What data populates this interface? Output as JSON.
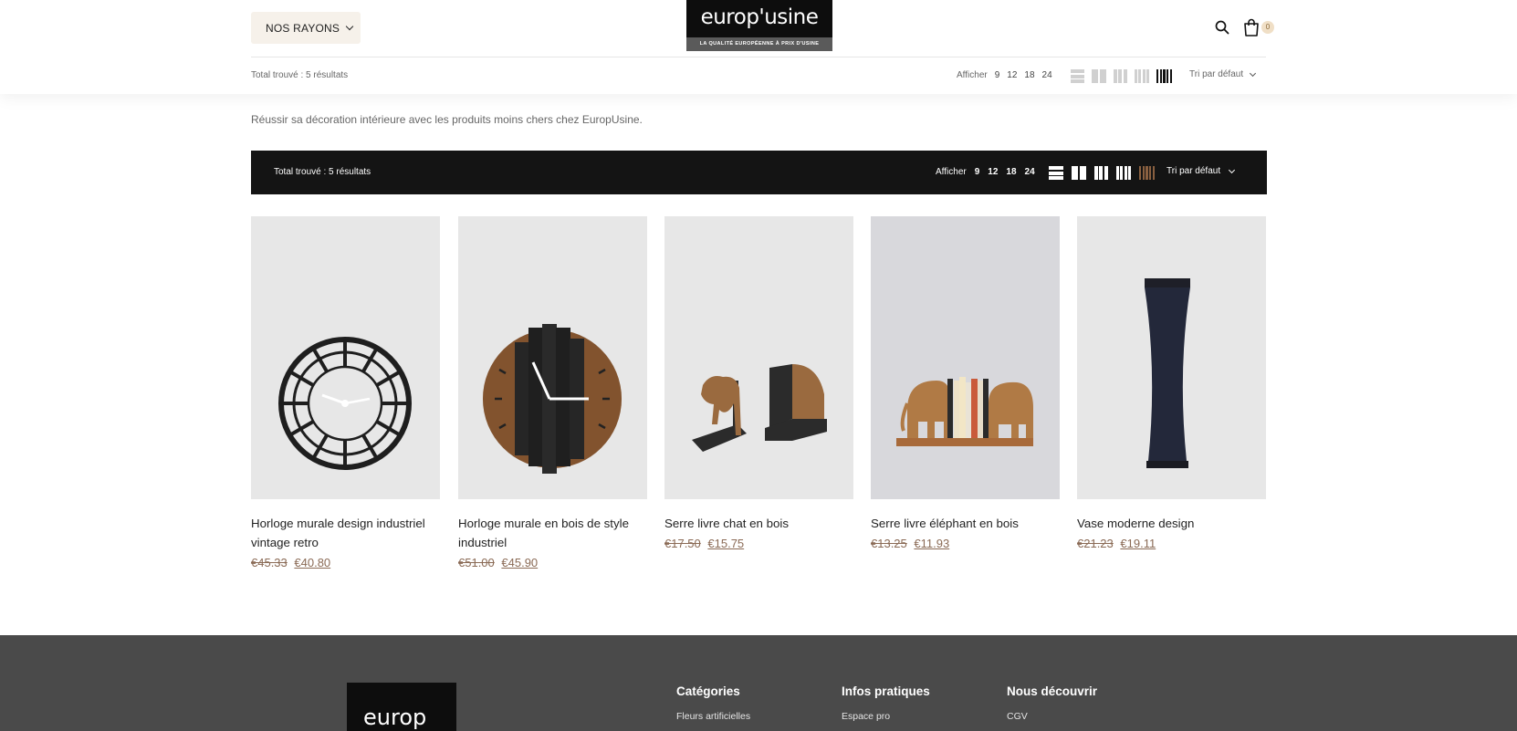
{
  "header": {
    "nav_label": "NOS RAYONS",
    "logo_text": "europ'usine",
    "logo_tagline": "LA QUALITÉ EUROPÉENNE À PRIX D'USINE",
    "cart_count": "0",
    "total_found": "Total trouvé : 5 résultats",
    "show_label": "Afficher",
    "show_options": [
      "9",
      "12",
      "18",
      "24"
    ],
    "sort_label": "Tri par défaut"
  },
  "intro_text": "Réussir sa décoration intérieure avec les produits moins chers chez EuropUsine.",
  "toolbar": {
    "total_found": "Total trouvé : 5 résultats",
    "show_label": "Afficher",
    "show_options": [
      "9",
      "12",
      "18",
      "24"
    ],
    "sort_label": "Tri par défaut",
    "active_grid_color": "#8a6040"
  },
  "products": [
    {
      "title": "Horloge murale design industriel vintage retro",
      "old_price": "€45.33",
      "new_price": "€40.80",
      "icon": "round-metal-clock"
    },
    {
      "title": "Horloge murale en bois de style industriel",
      "old_price": "€51.00",
      "new_price": "€45.90",
      "icon": "wood-plank-clock"
    },
    {
      "title": "Serre livre chat en bois",
      "old_price": "€17.50",
      "new_price": "€15.75",
      "icon": "cat-bookend"
    },
    {
      "title": "Serre livre éléphant en bois",
      "old_price": "€13.25",
      "new_price": "€11.93",
      "icon": "elephant-bookend"
    },
    {
      "title": "Vase moderne design",
      "old_price": "€21.23",
      "new_price": "€19.11",
      "icon": "tall-vase"
    }
  ],
  "footer": {
    "logo_text": "europ",
    "columns": [
      {
        "heading": "Catégories",
        "first_link": "Fleurs artificielles"
      },
      {
        "heading": "Infos pratiques",
        "first_link": "Espace pro"
      },
      {
        "heading": "Nous découvrir",
        "first_link": "CGV"
      }
    ]
  },
  "colors": {
    "accent": "#8a6a55",
    "toolbar_bg": "#141414",
    "footer_bg": "#4a4a4a",
    "nav_bg": "#f6f1ea"
  }
}
